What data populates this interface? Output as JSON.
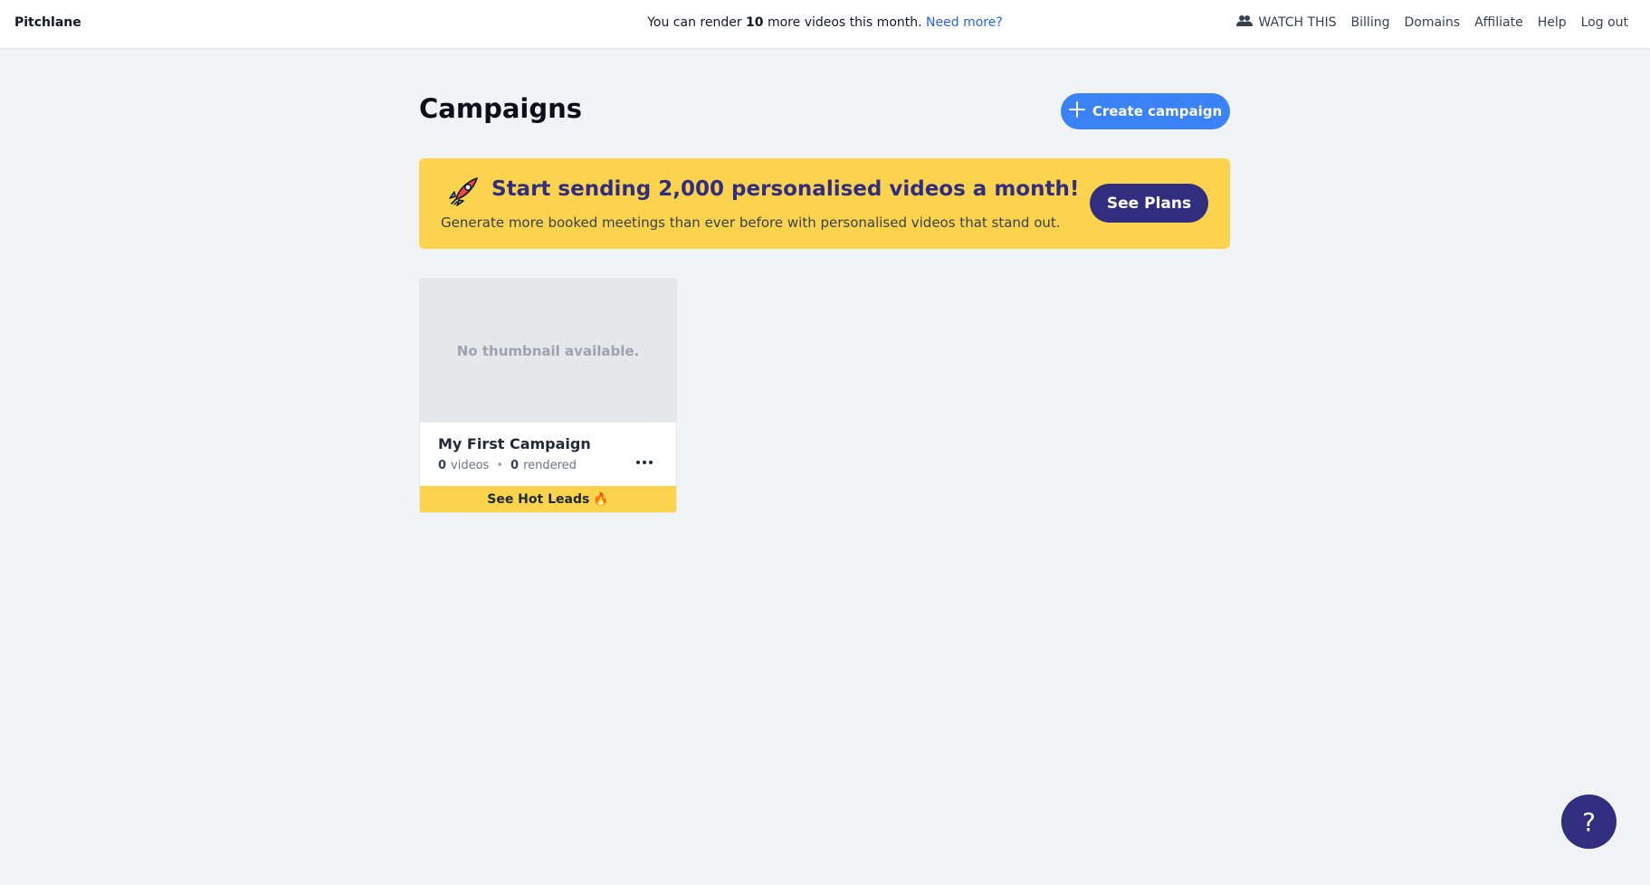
{
  "header": {
    "brand": "Pitchlane",
    "quota_prefix": "You can render ",
    "quota_count": "10",
    "quota_suffix": " more videos this month.",
    "quota_link": "Need more?",
    "nav": {
      "watch_icon": "users-icon",
      "watch": "WATCH THIS",
      "billing": "Billing",
      "domains": "Domains",
      "affiliate": "Affiliate",
      "help": "Help",
      "logout": "Log out"
    }
  },
  "main": {
    "title": "Campaigns",
    "create_button": "Create campaign",
    "create_icon": "plus-icon"
  },
  "promo": {
    "icon": "rocket-icon",
    "title": "Start sending 2,000 personalised videos a month!",
    "subtitle": "Generate more booked meetings than ever before with personalised videos that stand out.",
    "button": "See Plans"
  },
  "campaigns": [
    {
      "thumbnail_text": "No thumbnail available.",
      "name": "My First Campaign",
      "videos_count": "0",
      "videos_label": "videos",
      "separator": "•",
      "rendered_count": "0",
      "rendered_label": "rendered",
      "more_icon": "ellipsis-icon",
      "hot_leads": "See Hot Leads",
      "hot_leads_emoji": "🔥"
    }
  ],
  "help_fab": "?",
  "colors": {
    "page_bg": "#f2f3f5",
    "primary_blue": "#3b82f6",
    "promo_yellow": "#fcd34d",
    "indigo": "#312e81",
    "link": "#2563eb"
  }
}
